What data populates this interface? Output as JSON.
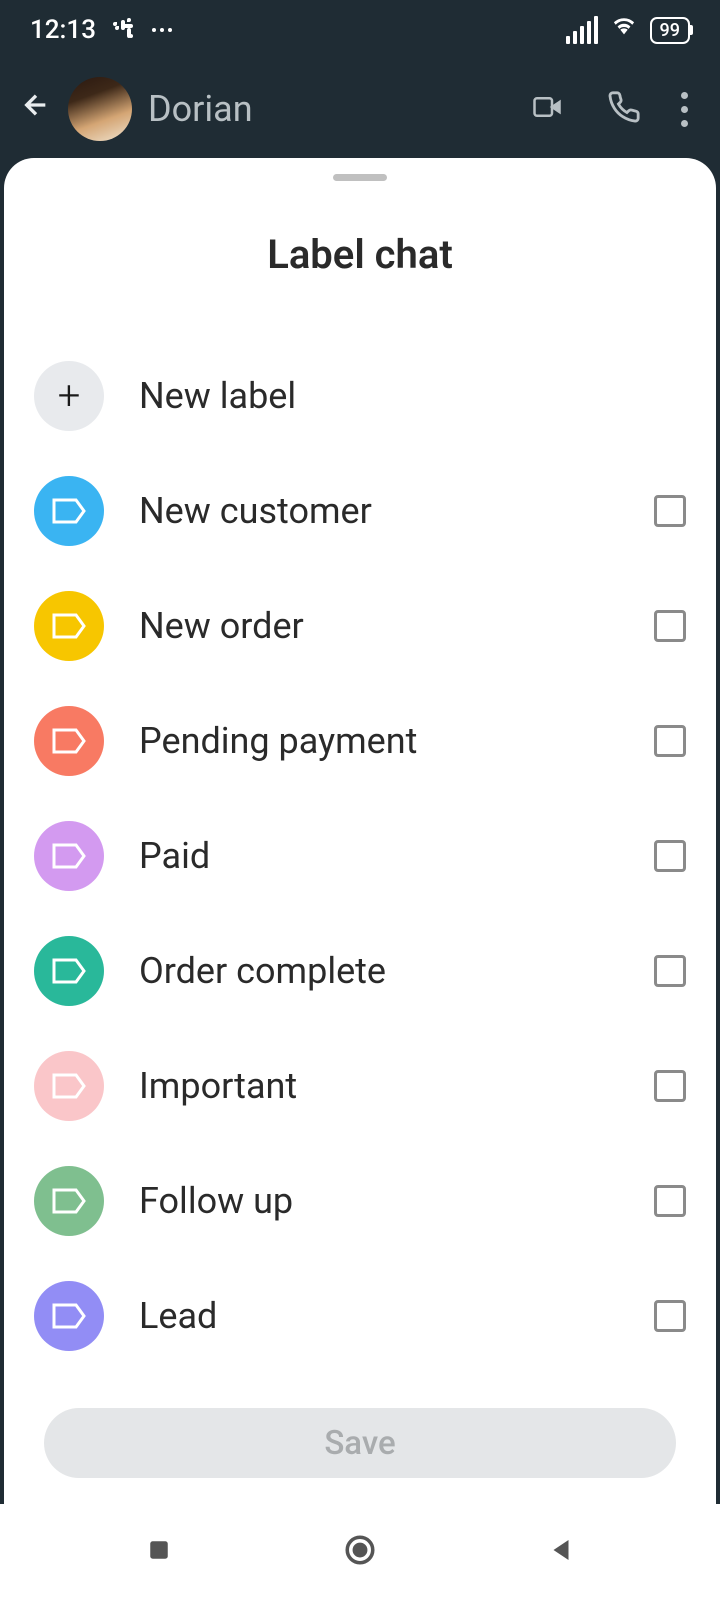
{
  "statusBar": {
    "time": "12:13",
    "battery": "99"
  },
  "header": {
    "contactName": "Dorian"
  },
  "sheet": {
    "title": "Label chat",
    "newLabel": "New label",
    "saveButton": "Save",
    "labels": [
      {
        "name": "New customer",
        "color": "#3ab4f2",
        "checked": false
      },
      {
        "name": "New order",
        "color": "#f7c600",
        "checked": false
      },
      {
        "name": "Pending payment",
        "color": "#f87a63",
        "checked": false
      },
      {
        "name": "Paid",
        "color": "#d39af0",
        "checked": false
      },
      {
        "name": "Order complete",
        "color": "#29b89a",
        "checked": false
      },
      {
        "name": "Important",
        "color": "#fac6c9",
        "checked": false
      },
      {
        "name": "Follow up",
        "color": "#7fbf8f",
        "checked": false
      },
      {
        "name": "Lead",
        "color": "#928df5",
        "checked": false
      }
    ]
  }
}
